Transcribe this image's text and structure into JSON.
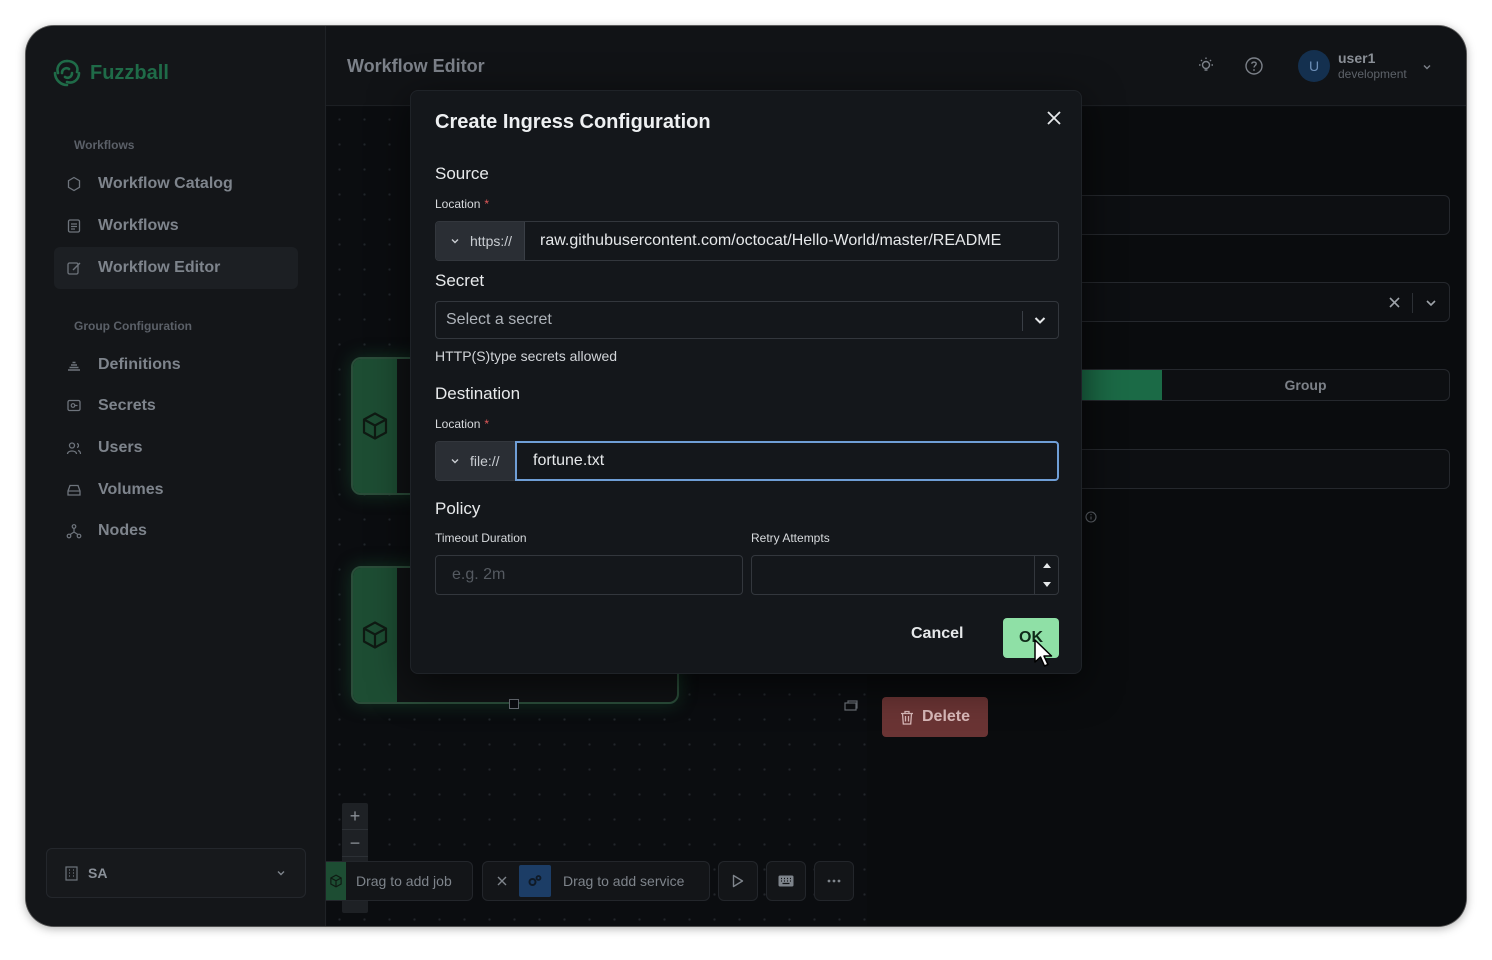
{
  "app": {
    "name": "Fuzzball"
  },
  "sidebar": {
    "section_workflows": "Workflows",
    "section_group": "Group Configuration",
    "items": [
      {
        "label": "Workflow Catalog",
        "icon": "hexagon-icon"
      },
      {
        "label": "Workflows",
        "icon": "list-icon"
      },
      {
        "label": "Workflow Editor",
        "icon": "edit-icon",
        "active": true
      },
      {
        "label": "Definitions",
        "icon": "stack-icon"
      },
      {
        "label": "Secrets",
        "icon": "key-icon"
      },
      {
        "label": "Users",
        "icon": "users-icon"
      },
      {
        "label": "Volumes",
        "icon": "drive-icon"
      },
      {
        "label": "Nodes",
        "icon": "nodes-icon"
      }
    ],
    "org": {
      "label": "SA"
    }
  },
  "header": {
    "title": "Workflow Editor",
    "user": {
      "initial": "U",
      "name": "user1",
      "role": "development"
    }
  },
  "canvas": {
    "add_job": "Drag to add job",
    "add_service": "Drag to add service",
    "zoom_in": "+",
    "zoom_out": "−"
  },
  "panel": {
    "group_label": "Group",
    "delete_label": "Delete"
  },
  "modal": {
    "title": "Create Ingress Configuration",
    "source": {
      "heading": "Source",
      "location_label": "Location",
      "prefix": "https://",
      "value": "raw.githubusercontent.com/octocat/Hello-World/master/README"
    },
    "secret": {
      "heading": "Secret",
      "placeholder": "Select a secret",
      "hint": "HTTP(S)type secrets allowed"
    },
    "destination": {
      "heading": "Destination",
      "location_label": "Location",
      "prefix": "file://",
      "value": "fortune.txt"
    },
    "policy": {
      "heading": "Policy",
      "timeout_label": "Timeout Duration",
      "timeout_placeholder": "e.g. 2m",
      "retry_label": "Retry Attempts"
    },
    "cancel_label": "Cancel",
    "ok_label": "OK"
  },
  "colors": {
    "brand": "#1f6b48",
    "ok_button": "#8fe0a6",
    "focus_ring": "#6f9ed6",
    "delete_button": "#6a3434"
  }
}
